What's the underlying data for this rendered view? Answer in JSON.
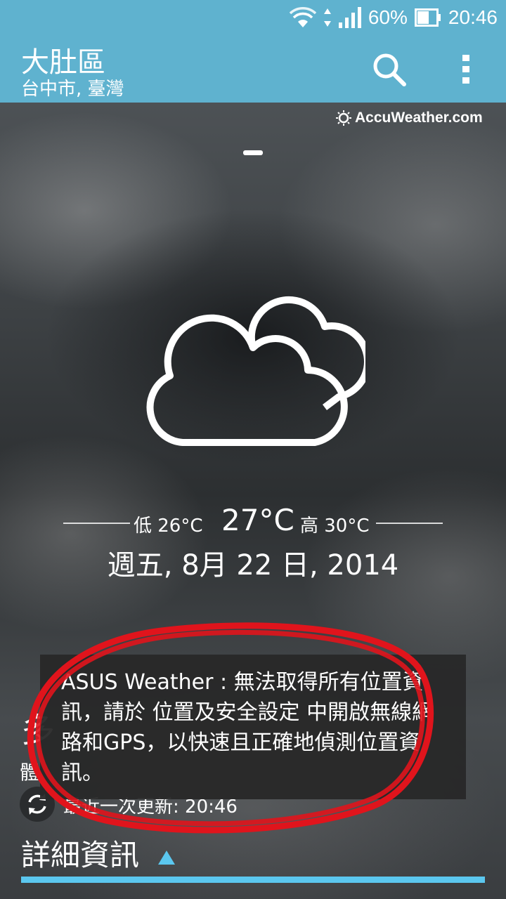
{
  "status_bar": {
    "battery_percent": "60%",
    "time": "20:46"
  },
  "app_bar": {
    "title": "大肚區",
    "subtitle": "台中市, 臺灣",
    "icons": [
      "search-icon",
      "overflow-menu-icon"
    ]
  },
  "provider": {
    "label": "AccuWeather.com"
  },
  "weather": {
    "condition_icon": "mostly-cloudy-icon",
    "low": "低 26°C",
    "current": "27°C",
    "high": "高 30°C",
    "date": "週五, 8月 22 日, 2014"
  },
  "forecast_partial": {
    "big_text": "多",
    "small_text": "體",
    "last_updated": "最近一次更新: 20:46"
  },
  "toast": {
    "message": "ASUS Weather : 無法取得所有位置資訊，請於 位置及安全設定 中開啟無線網路和GPS，以快速且正確地偵測位置資訊。"
  },
  "details": {
    "label": "詳細資訊"
  },
  "colors": {
    "app_bar": "#5fb2cf",
    "details_bar": "#5bc7ef",
    "annotation": "#e0141c"
  }
}
